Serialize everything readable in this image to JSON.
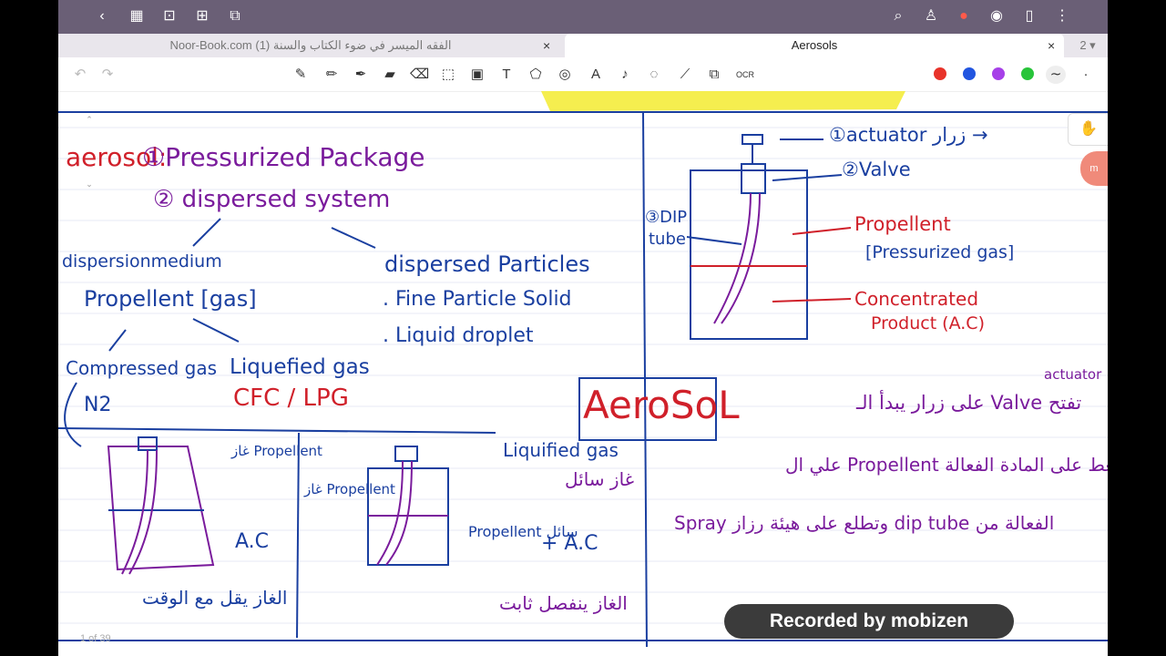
{
  "app": {
    "topbar_icons": [
      "back-icon",
      "grid-icon",
      "bookmark-icon",
      "add-page-icon",
      "crop-icon",
      "search-icon",
      "shirt-icon",
      "record-icon",
      "eye-icon",
      "reader-icon",
      "more-icon"
    ],
    "tabs": [
      {
        "label": "Noor-Book.com  (1) الفقه الميسر في ضوء الكتاب والسنة",
        "active": false
      },
      {
        "label": "Aerosols",
        "active": true
      }
    ],
    "tab_count": "2",
    "colors": {
      "accent_red": "#e8332a",
      "blue": "#2155e0",
      "purple": "#a640e8",
      "green": "#28c43a"
    }
  },
  "notes": {
    "title_left": "aerosol:",
    "title_right": "①Pressurized Package",
    "line2": "② dispersed system",
    "disp_medium": "dispersionmedium",
    "disp_particles": "dispersed Particles",
    "propellent": "Propellent [gas]",
    "fine": ". Fine Particle Solid",
    "liquid": ". Liquid droplet",
    "compressed": "Compressed gas",
    "liquefied": "Liquefied gas",
    "n2": "N2",
    "cfc": "CFC / LPG",
    "actuator": "①actuator زرار →",
    "valve": "②Valve",
    "dip": "③DIP",
    "tube": "tube",
    "propellent_r": "Propellent",
    "pressurized_gas": "[Pressurized gas]",
    "concentrated": "Concentrated",
    "product": "Product (A.C)",
    "aerosol_box": "AeroSoL",
    "actuator2": "actuator",
    "ar1": "على زرار يبدأ الـ Valve تفتح",
    "ar2": "علي ال Propellent يضغط على المادة الفعالة",
    "ar3": "Spray وتطلع على هيئة رزاز dip tube الفعالة من",
    "gas_prop1": "غاز Propellent",
    "ac1": "A.C",
    "gas_prop2": "غاز Propellent",
    "prop_liq": "Propellent سائل",
    "plus_ac": "+ A.C",
    "liquefied_gas2": "Liquified gas",
    "gas_liquid": "غاز سائل",
    "ar_bottom1": "الغاز يقل مع الوقت",
    "ar_bottom2": "الغاز ينفصل ثابت",
    "page_counter": "1 of 39"
  },
  "recording": {
    "label": "Recorded by mobizen"
  }
}
